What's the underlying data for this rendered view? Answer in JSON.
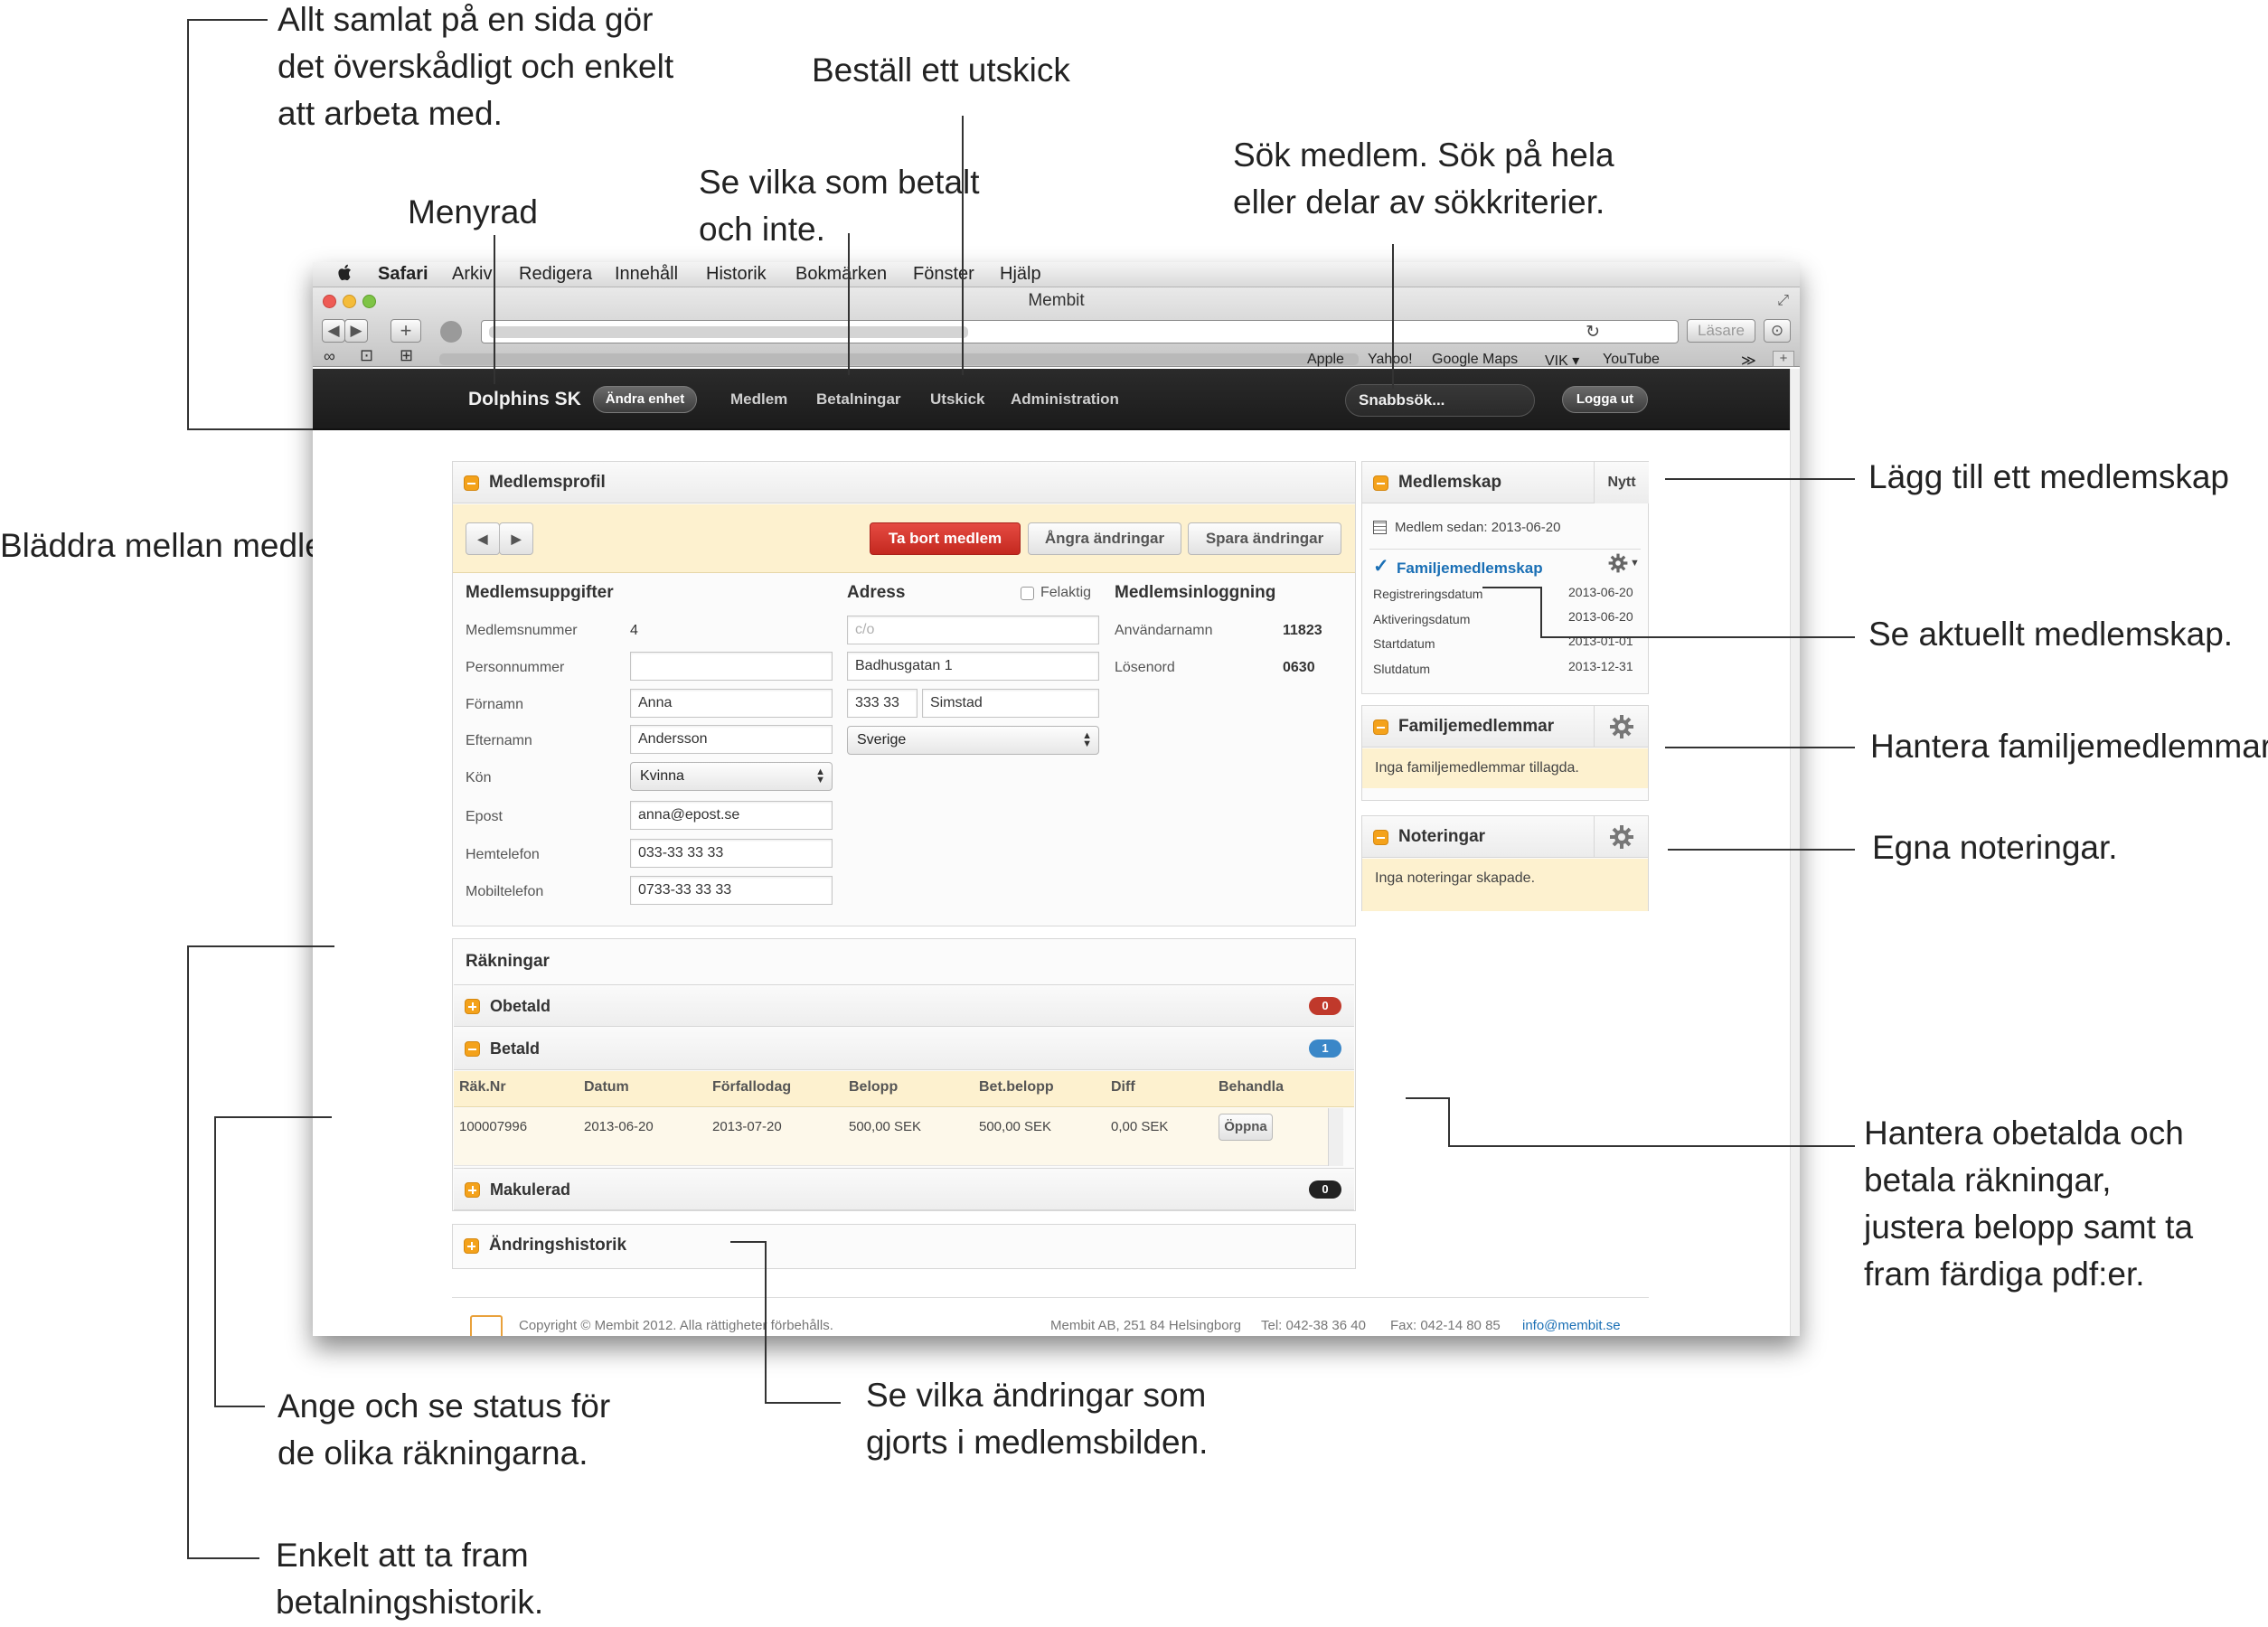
{
  "callouts": {
    "allt": [
      "Allt samlat på en sida gör",
      "det överskådligt och enkelt",
      "att arbeta med."
    ],
    "bestall": "Beställ ett utskick",
    "menyrad": "Menyrad",
    "sevilka": [
      "Se vilka som betalt",
      "och inte."
    ],
    "sok": [
      "Sök medlem. Sök på hela",
      "eller delar av sökkriterier."
    ],
    "bladdra": "Bläddra mellan medlemmar.",
    "lagg": "Lägg till ett medlemskap",
    "aktuellt": "Se aktuellt medlemskap.",
    "familj": "Hantera familjemedlemmar.",
    "egna": "Egna noteringar.",
    "obetalda": [
      "Hantera obetalda och",
      "betala räkningar,",
      "justera belopp samt ta",
      "fram färdiga pdf:er."
    ],
    "ange": [
      "Ange och se status för",
      "de olika räkningarna."
    ],
    "andringar": [
      "Se vilka ändringar som",
      "gjorts i medlemsbilden."
    ],
    "enkelt": [
      "Enkelt att ta fram",
      "betalningshistorik."
    ]
  },
  "macmenu": {
    "apple": "",
    "app": "Safari",
    "items": [
      "Arkiv",
      "Redigera",
      "Innehåll",
      "Historik",
      "Bokmärken",
      "Fönster",
      "Hjälp"
    ]
  },
  "window": {
    "title": "Membit",
    "reader": "Läsare",
    "bookmarks": [
      "Apple",
      "Yahoo!",
      "Google Maps",
      "VIK ▾",
      "YouTube"
    ],
    "more": "≫"
  },
  "appbar": {
    "brand": "Dolphins SK",
    "change_unit": "Ändra enhet",
    "nav": [
      "Medlem",
      "Betalningar",
      "Utskick",
      "Administration"
    ],
    "quicksearch": "Snabbsök...",
    "logout": "Logga ut"
  },
  "profile": {
    "title": "Medlemsprofil",
    "prev": "◀",
    "next": "▶",
    "delete": "Ta bort medlem",
    "undo": "Ångra ändringar",
    "save": "Spara ändringar",
    "details_title": "Medlemsuppgifter",
    "labels": [
      "Medlemsnummer",
      "Personnummer",
      "Förnamn",
      "Efternamn",
      "Kön",
      "Epost",
      "Hemtelefon",
      "Mobiltelefon"
    ],
    "member_number": "4",
    "personnummer": "",
    "first_name": "Anna",
    "last_name": "Andersson",
    "gender": "Kvinna",
    "email": "anna@epost.se",
    "home_phone": "033-33 33 33",
    "mobile": "0733-33 33 33",
    "address_title": "Adress",
    "faulty_label": "Felaktig",
    "co_placeholder": "c/o",
    "street": "Badhusgatan 1",
    "zip": "333 33",
    "city": "Simstad",
    "country": "Sverige",
    "login_title": "Medlemsinloggning",
    "username_label": "Användarnamn",
    "username": "11823",
    "password_label": "Lösenord",
    "password": "0630"
  },
  "membership": {
    "title": "Medlemskap",
    "new": "Nytt",
    "since": "Medlem sedan: 2013-06-20",
    "type": "Familjemedlemskap",
    "rows": [
      {
        "label": "Registreringsdatum",
        "value": "2013-06-20"
      },
      {
        "label": "Aktiveringsdatum",
        "value": "2013-06-20"
      },
      {
        "label": "Startdatum",
        "value": "2013-01-01"
      },
      {
        "label": "Slutdatum",
        "value": "2013-12-31"
      }
    ]
  },
  "family": {
    "title": "Familjemedlemmar",
    "empty": "Inga familjemedlemmar tillagda."
  },
  "notes": {
    "title": "Noteringar",
    "empty": "Inga noteringar skapade."
  },
  "invoices": {
    "title": "Räkningar",
    "unpaid": "Obetald",
    "unpaid_count": "0",
    "paid": "Betald",
    "paid_count": "1",
    "cancelled": "Makulerad",
    "cancelled_count": "0",
    "columns": [
      "Räk.Nr",
      "Datum",
      "Förfallodag",
      "Belopp",
      "Bet.belopp",
      "Diff",
      "Behandla"
    ],
    "row": {
      "nr": "100007996",
      "date": "2013-06-20",
      "due": "2013-07-20",
      "amount": "500,00 SEK",
      "paid": "500,00 SEK",
      "diff": "0,00 SEK",
      "action": "Öppna"
    }
  },
  "history": {
    "title": "Ändringshistorik"
  },
  "footer": {
    "copyright": "Copyright © Membit 2012. Alla rättigheter förbehålls.",
    "address": "Membit AB, 251 84 Helsingborg",
    "tel": "Tel: 042-38 36 40",
    "fax": "Fax: 042-14 80 85",
    "email": "info@membit.se"
  },
  "colors": {
    "accent": "#f4a21b",
    "danger": "#d9322a",
    "link": "#1a6fb5",
    "highlight": "#fdf1cf",
    "badge_red": "#c0392b",
    "badge_blue": "#3a87c8",
    "badge_dark": "#222222"
  }
}
